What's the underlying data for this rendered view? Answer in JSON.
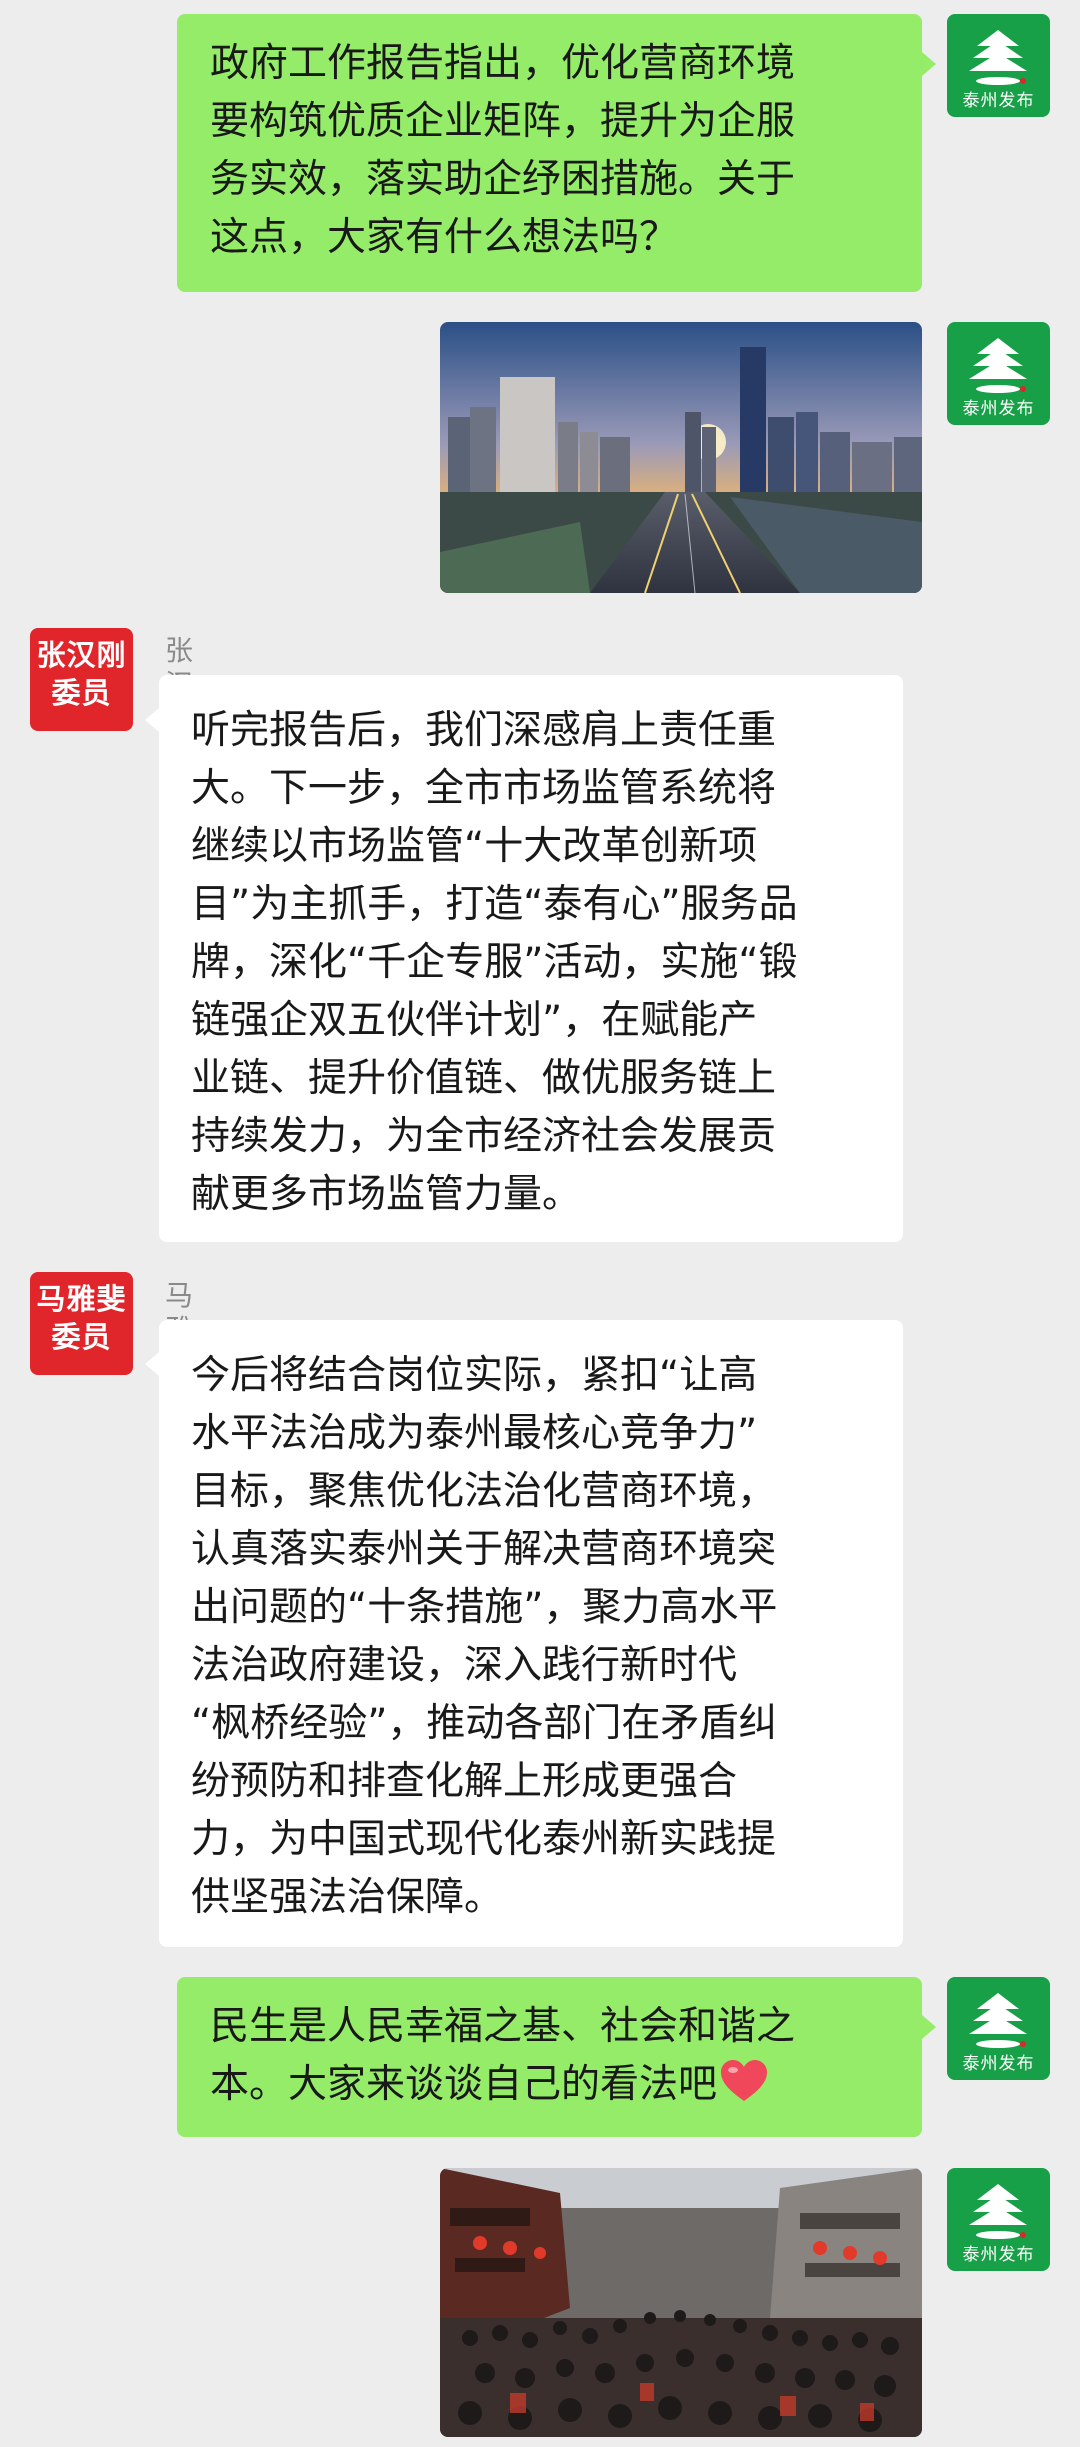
{
  "messages": [
    {
      "sender": "泰州发布",
      "lines": [
        "政府工作报告指出，优化营商环境",
        "要构筑优质企业矩阵，提升为企服",
        "务实效，落实助企纾困措施。关于",
        "这点，大家有什么想法吗？"
      ]
    },
    {
      "sender": "泰州发布",
      "image": "city-skyline-photo"
    },
    {
      "sender": "张汉刚委员",
      "avatar_lines": [
        "张汉刚",
        "委员"
      ],
      "lines": [
        "听完报告后，我们深感肩上责任重",
        "大。下一步，全市市场监管系统将",
        "继续以市场监管“十大改革创新项",
        "目”为主抓手，打造“泰有心”服务品",
        "牌，深化“千企专服”活动，实施“锻",
        "链强企双五伙伴计划”，在赋能产",
        "业链、提升价值链、做优服务链上",
        "持续发力，为全市经济社会发展贡",
        "献更多市场监管力量。"
      ]
    },
    {
      "sender": "马雅斐委员",
      "avatar_lines": [
        "马雅斐",
        "委员"
      ],
      "lines": [
        "今后将结合岗位实际，紧扣“让高",
        "水平法治成为泰州最核心竞争力”",
        "目标，聚焦优化法治化营商环境，",
        "认真落实泰州关于解决营商环境突",
        "出问题的“十条措施”，聚力高水平",
        "法治政府建设，深入践行新时代",
        "“枫桥经验”，推动各部门在矛盾纠",
        "纷预防和排查化解上形成更强合",
        "力，为中国式现代化泰州新实践提",
        "供坚强法治保障。"
      ]
    },
    {
      "sender": "泰州发布",
      "lines": [
        "民生是人民幸福之基、社会和谐之",
        "本。大家来谈谈自己的看法吧"
      ],
      "emoji": "heart-icon"
    },
    {
      "sender": "泰州发布",
      "image": "crowd-street-photo"
    }
  ],
  "official_avatar": {
    "label": "泰州发布",
    "color": "#17a047"
  },
  "colors": {
    "green_bubble": "#95ec69",
    "white_bubble": "#ffffff",
    "background": "#ededed",
    "heart": "#f0475a"
  }
}
